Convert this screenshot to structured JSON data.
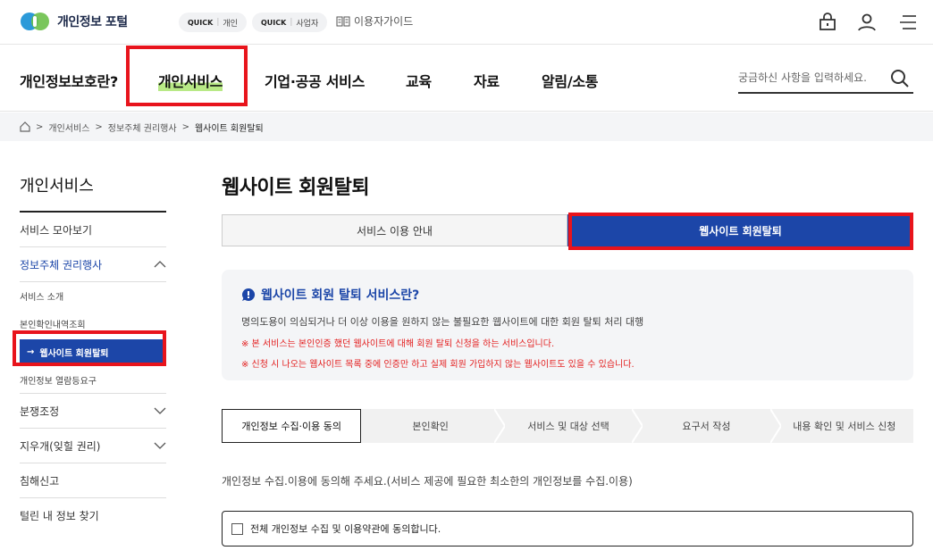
{
  "brand": {
    "name": "개인정보 포털"
  },
  "quick": [
    {
      "tag": "QUICK",
      "label": "개인"
    },
    {
      "tag": "QUICK",
      "label": "사업자"
    }
  ],
  "guide_label": "이용자가이드",
  "icons": {
    "lock": "lock-icon",
    "user": "user-icon",
    "menu": "hamburger-menu-icon",
    "search": "search-icon",
    "home": "home-icon"
  },
  "gnb": [
    "개인정보보호란?",
    "개인서비스",
    "기업·공공 서비스",
    "교육",
    "자료",
    "알림/소통"
  ],
  "search": {
    "placeholder": "궁금하신 사항을 입력하세요."
  },
  "breadcrumb": [
    "개인서비스",
    "정보주체 권리행사",
    "웹사이트 회원탈퇴"
  ],
  "lnb": {
    "title": "개인서비스",
    "items": [
      "서비스 모아보기",
      "정보주체 권리행사",
      "분쟁조정",
      "지우개(잊힐 권리)",
      "침해신고",
      "털린 내 정보 찾기"
    ],
    "subs": [
      "서비스 소개",
      "본인확인내역조회",
      "웹사이트 회원탈퇴",
      "개인정보 열람등요구"
    ]
  },
  "page": {
    "title": "웹사이트 회원탈퇴"
  },
  "tabs": [
    "서비스 이용 안내",
    "웹사이트 회원탈퇴"
  ],
  "info": {
    "heading": "웹사이트 회원 탈퇴 서비스란?",
    "desc": "명의도용이 의심되거나 더 이상 이용을 원하지 않는 불필요한 웹사이트에 대한 회원 탈퇴 처리 대행",
    "warn1": "※ 본 서비스는 본인인증 했던 웹사이트에 대해 회원 탈퇴 신청을 하는 서비스입니다.",
    "warn2": "※ 신청 시 나오는 웹사이트 목록 중에 인증만 하고 실제 회원 가입하지 않는 웹사이트도 있을 수 있습니다."
  },
  "steps": [
    "개인정보 수집·이용 동의",
    "본인확인",
    "서비스 및 대상 선택",
    "요구서 작성",
    "내용 확인 및 서비스 신청"
  ],
  "consent": {
    "text": "개인정보 수집.이용에 동의해 주세요.(서비스 제공에 필요한 최소한의 개인정보를 수집.이용)",
    "agree_all": "전체 개인정보 수집 및 이용약관에 동의합니다."
  },
  "colors": {
    "accent": "#1c46a8",
    "highlight": "#b8e986",
    "annotation": "#e8141c",
    "warning": "#e32020"
  }
}
